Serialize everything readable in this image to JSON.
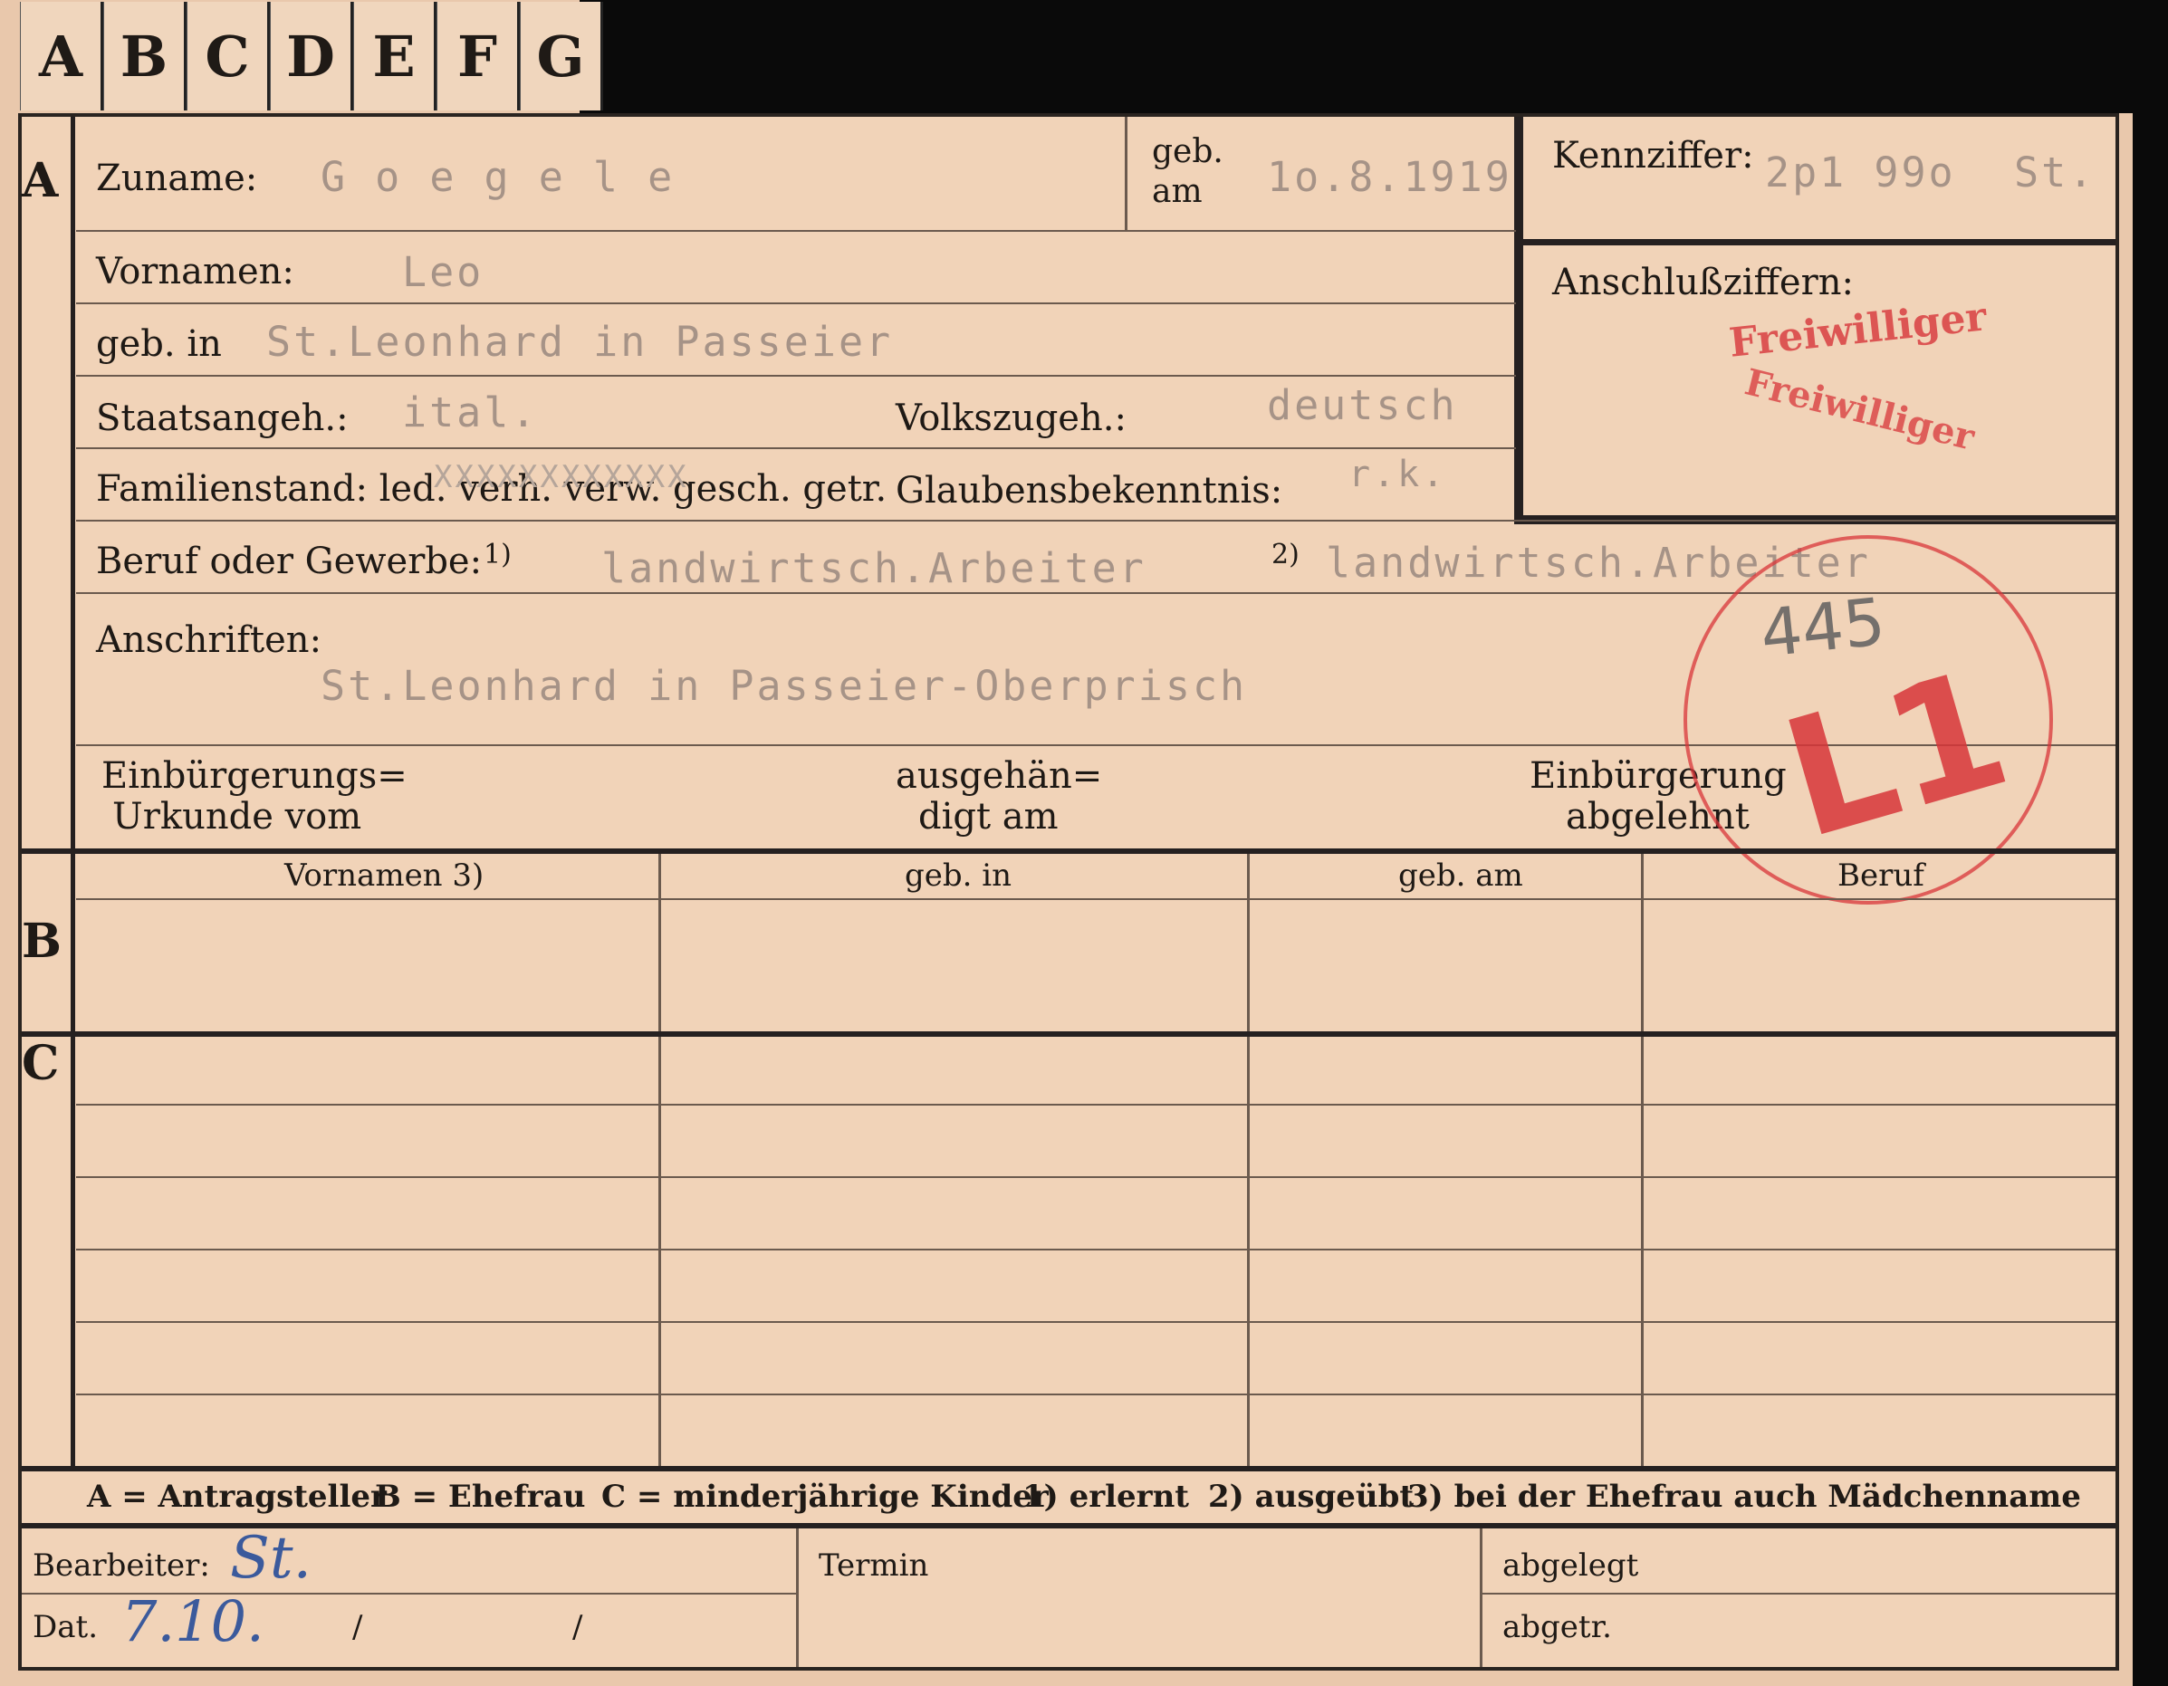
{
  "tabs": [
    "A",
    "B",
    "C",
    "D",
    "E",
    "F",
    "G"
  ],
  "sections": {
    "a": "A",
    "b": "B",
    "c": "C"
  },
  "header": {
    "zuname_label": "Zuname:",
    "zuname_value": "G o e g e l e",
    "geb_am_label_1": "geb.",
    "geb_am_label_2": "am",
    "geb_am_value": "1o.8.1919",
    "kennziffer_label": "Kennziffer:",
    "kennziffer_value": "2p1 99o",
    "kennziffer_suffix": "St.",
    "vornamen_label": "Vornamen:",
    "vornamen_value": "Leo",
    "geb_in_label": "geb. in",
    "geb_in_value": "St.Leonhard in Passeier",
    "anschluss_label": "Anschlußziffern:",
    "stamp_freiwilliger": "Freiwilliger",
    "stamp_freiwilliger_2": "Freiwilliger",
    "staatsangeh_label": "Staatsangeh.:",
    "staatsangeh_value": "ital.",
    "volkszugeh_label": "Volkszugeh.:",
    "volkszugeh_value": "deutsch",
    "familienstand_label": "Familienstand: led. verh. verw. gesch. getr.",
    "familienstand_strike": "XXXXXXXXXXXX",
    "glaubens_label": "Glaubensbekenntnis:",
    "glaubens_value": "r.k.",
    "beruf_label": "Beruf oder Gewerbe:",
    "beruf_note1": "1)",
    "beruf_value1": "landwirtsch.Arbeiter",
    "beruf_note2": "2)",
    "beruf_value2": "landwirtsch.Arbeiter",
    "anschriften_label": "Anschriften:",
    "anschriften_value": "St.Leonhard in Passeier-Oberprisch",
    "einb_label_1": "Einbürgerungs=",
    "einb_label_2": "Urkunde vom",
    "ausgeh_label_1": "ausgehän=",
    "ausgeh_label_2": "digt am",
    "abgelehnt_label_1": "Einbürgerung",
    "abgelehnt_label_2": "abgelehnt",
    "stamp_number": "445",
    "stamp_code": "L1"
  },
  "table": {
    "columns": [
      "Vornamen 3)",
      "geb. in",
      "geb. am",
      "Beruf"
    ]
  },
  "legend": {
    "a": "A = Antragsteller",
    "b": "B = Ehefrau",
    "c": "C = minderjährige Kinder",
    "n1": "1) erlernt",
    "n2": "2) ausgeübt",
    "n3": "3) bei der Ehefrau auch Mädchenname"
  },
  "footer": {
    "bearbeiter_label": "Bearbeiter:",
    "bearbeiter_value": "St.",
    "dat_label": "Dat.",
    "dat_value": "7.10.",
    "slash": "/",
    "termin_label": "Termin",
    "abgelegt_label": "abgelegt",
    "abgetr_label": "abgetr."
  }
}
